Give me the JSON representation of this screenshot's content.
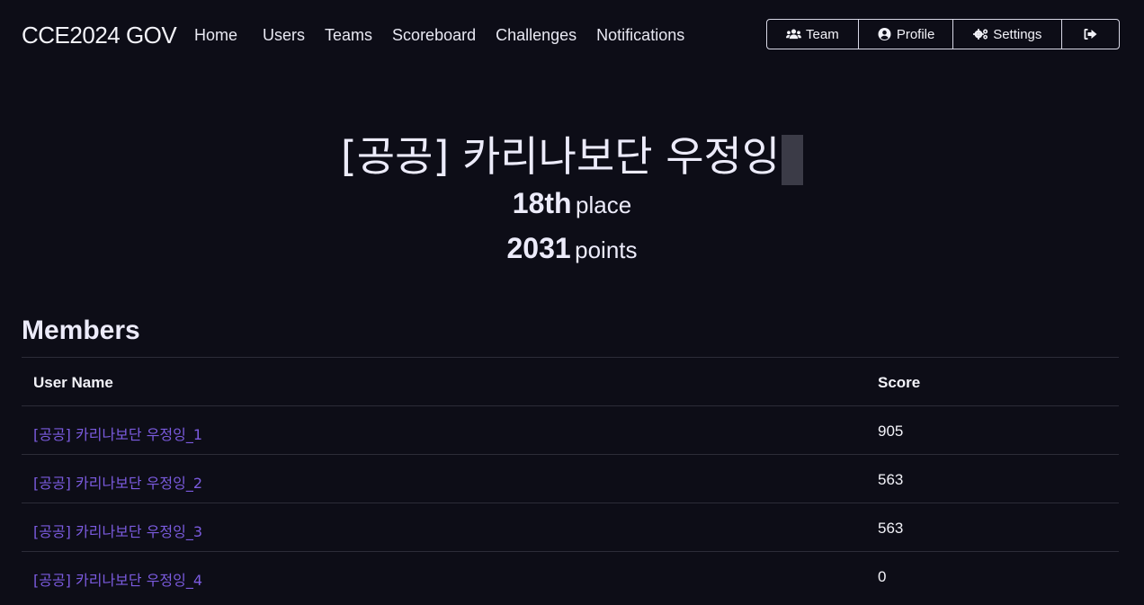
{
  "nav": {
    "brand": "CCE2024 GOV",
    "links": [
      "Home",
      "Users",
      "Teams",
      "Scoreboard",
      "Challenges",
      "Notifications"
    ],
    "buttons": [
      {
        "label": "Team",
        "icon": "users-icon"
      },
      {
        "label": "Profile",
        "icon": "user-circle-icon"
      },
      {
        "label": "Settings",
        "icon": "gears-icon"
      },
      {
        "label": "",
        "icon": "logout-icon"
      }
    ]
  },
  "team": {
    "name": "[공공] 카리나보단 우정잉",
    "place_num": "18th",
    "place_label": "place",
    "points_num": "2031",
    "points_label": "points"
  },
  "members": {
    "title": "Members",
    "columns": [
      "User Name",
      "Score"
    ],
    "rows": [
      {
        "name": "[공공] 카리나보단 우정잉_1",
        "score": "905"
      },
      {
        "name": "[공공] 카리나보단 우정잉_2",
        "score": "563"
      },
      {
        "name": "[공공] 카리나보단 우정잉_3",
        "score": "563"
      },
      {
        "name": "[공공] 카리나보단 우정잉_4",
        "score": "0"
      }
    ]
  },
  "colors": {
    "background": "#0d0d17",
    "link": "#7b5bdf",
    "text": "#ecebfa"
  }
}
